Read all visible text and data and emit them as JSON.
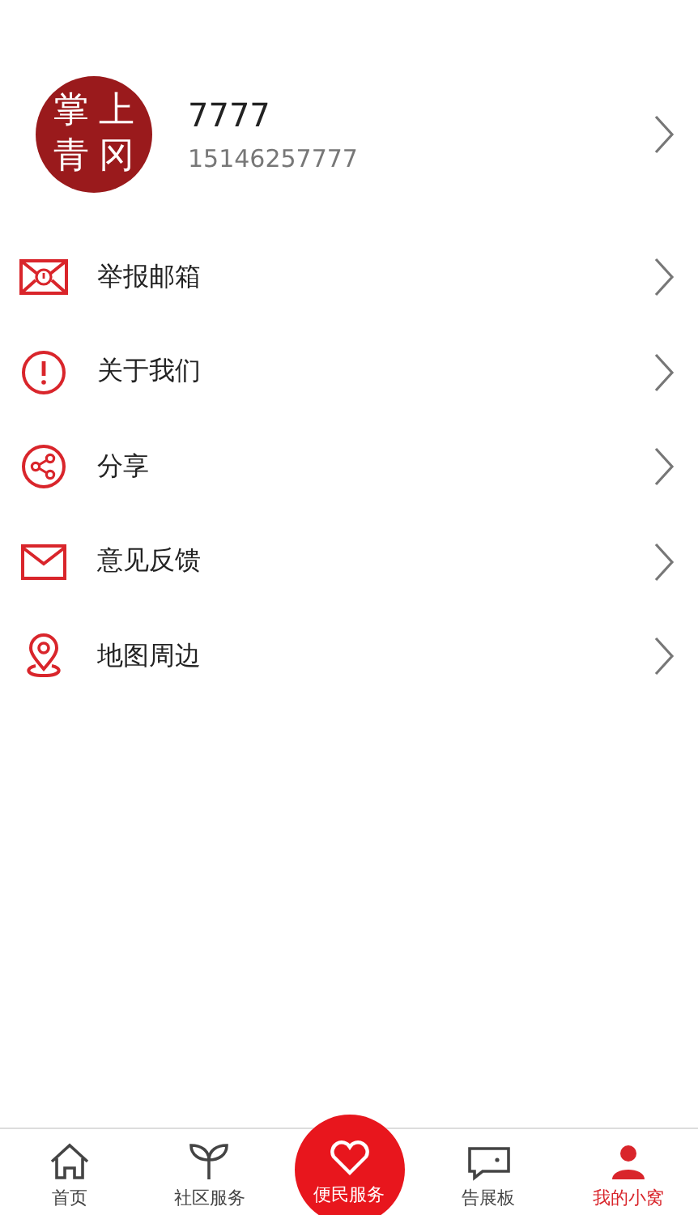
{
  "profile": {
    "avatar_chars": [
      "掌",
      "上",
      "青",
      "冈"
    ],
    "name": "7777",
    "phone": "15146257777"
  },
  "menu": [
    {
      "kind": "report-mail",
      "label": "举报邮箱"
    },
    {
      "kind": "info",
      "label": "关于我们"
    },
    {
      "kind": "share",
      "label": "分享"
    },
    {
      "kind": "mail",
      "label": "意见反馈"
    },
    {
      "kind": "location",
      "label": "地图周边"
    }
  ],
  "tabs": [
    {
      "kind": "home",
      "label": "首页",
      "selected": false
    },
    {
      "kind": "sprout",
      "label": "社区服务",
      "selected": false
    },
    {
      "kind": "heart",
      "label": "便民服务",
      "selected": false
    },
    {
      "kind": "chat",
      "label": "告展板",
      "selected": false
    },
    {
      "kind": "person",
      "label": "我的小窝",
      "selected": true
    }
  ]
}
